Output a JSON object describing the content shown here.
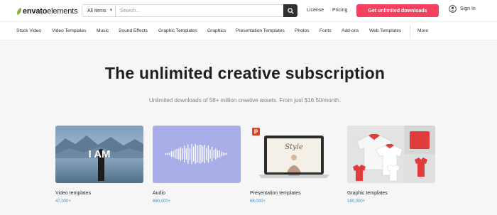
{
  "header": {
    "logo": {
      "part1": "envato",
      "part2": "elements"
    },
    "search": {
      "category": "All items",
      "placeholder": "Search..."
    },
    "links": {
      "license": "License",
      "pricing": "Pricing"
    },
    "cta_label": "Get unlimited downloads",
    "signin_label": "Sign In"
  },
  "nav": {
    "items": [
      "Stock Video",
      "Video Templates",
      "Music",
      "Sound Effects",
      "Graphic Templates",
      "Graphics",
      "Presentation Templates",
      "Photos",
      "Fonts",
      "Add-ons",
      "Web Templates"
    ],
    "more_label": "More"
  },
  "hero": {
    "title": "The unlimited creative subscription",
    "subtitle": "Unlimited downloads of 58+ million creative assets. From just $16.50/month."
  },
  "cards": [
    {
      "label": "Video templates",
      "count": "47,000+",
      "overlay_text": "I AM"
    },
    {
      "label": "Audio",
      "count": "690,000+"
    },
    {
      "label": "Presentation templates",
      "count": "68,000+",
      "screen_text": "Style",
      "badge_text": "P"
    },
    {
      "label": "Graphic templates",
      "count": "180,000+"
    }
  ],
  "colors": {
    "accent": "#f5405f",
    "brand_green": "#82b541",
    "count_blue": "#4a90c0",
    "audio_bg": "#a9aee8"
  }
}
